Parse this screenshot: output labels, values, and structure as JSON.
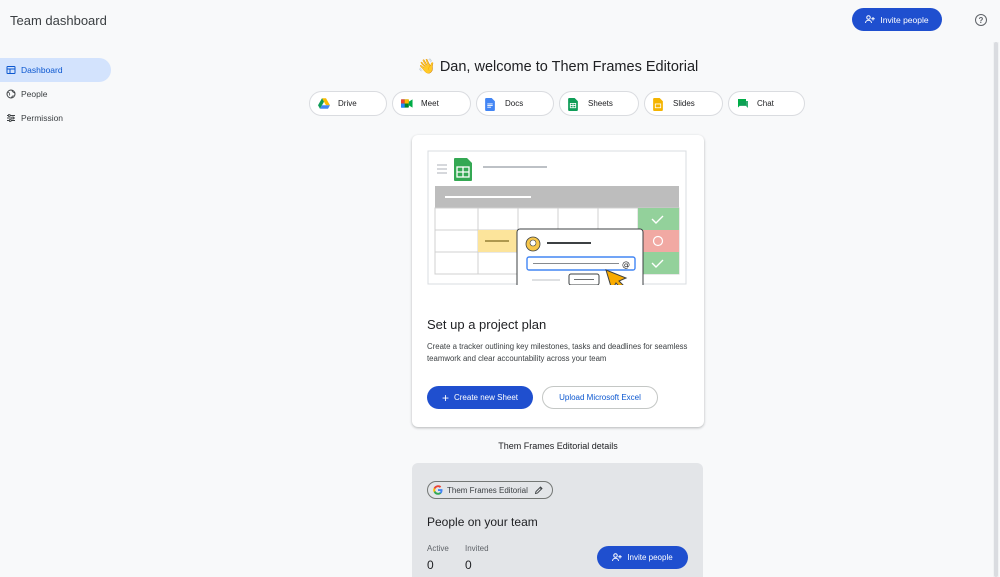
{
  "header": {
    "title": "Team dashboard",
    "invite_label": "Invite people",
    "help_icon": "help-circle-icon"
  },
  "sidebar": {
    "items": [
      {
        "label": "Dashboard",
        "icon": "dashboard-icon",
        "active": true
      },
      {
        "label": "People",
        "icon": "globe-icon",
        "active": false
      },
      {
        "label": "Permission",
        "icon": "sliders-icon",
        "active": false
      }
    ]
  },
  "main": {
    "welcome_emoji": "👋",
    "welcome_text": "Dan, welcome to Them Frames Editorial",
    "apps": [
      {
        "label": "Drive",
        "icon": "drive-icon"
      },
      {
        "label": "Meet",
        "icon": "meet-icon"
      },
      {
        "label": "Docs",
        "icon": "docs-icon"
      },
      {
        "label": "Sheets",
        "icon": "sheets-icon"
      },
      {
        "label": "Slides",
        "icon": "slides-icon"
      },
      {
        "label": "Chat",
        "icon": "chat-icon"
      }
    ],
    "card": {
      "title": "Set up a project plan",
      "description": "Create a tracker outlining key milestones, tasks and deadlines for seamless teamwork and clear accountability across your team",
      "create_label": "Create new Sheet",
      "upload_label": "Upload Microsoft Excel"
    },
    "details_title": "Them Frames Editorial details",
    "details": {
      "org_name": "Them Frames Editorial",
      "people_title": "People on your team",
      "active_label": "Active",
      "active_value": "0",
      "invited_label": "Invited",
      "invited_value": "0",
      "invite_label": "Invite people"
    }
  },
  "colors": {
    "primary": "#1f4fcf",
    "active_nav_bg": "#d3e3fd",
    "sheets_green": "#188038"
  }
}
